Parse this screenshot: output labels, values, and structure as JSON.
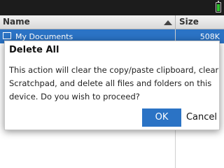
{
  "columns": {
    "name": "Name",
    "size": "Size"
  },
  "files": [
    {
      "name": "My Documents",
      "size": "508K"
    }
  ],
  "dialog": {
    "title": "Delete All",
    "message": "This action will clear the copy/paste clipboard, clear Scratchpad, and delete all files and folders on this device. Do you wish to proceed?",
    "ok_label": "OK",
    "cancel_label": "Cancel"
  },
  "colors": {
    "accent": "#2b73c5",
    "statusbar": "#1c1c1c",
    "battery": "#2ec12e"
  }
}
